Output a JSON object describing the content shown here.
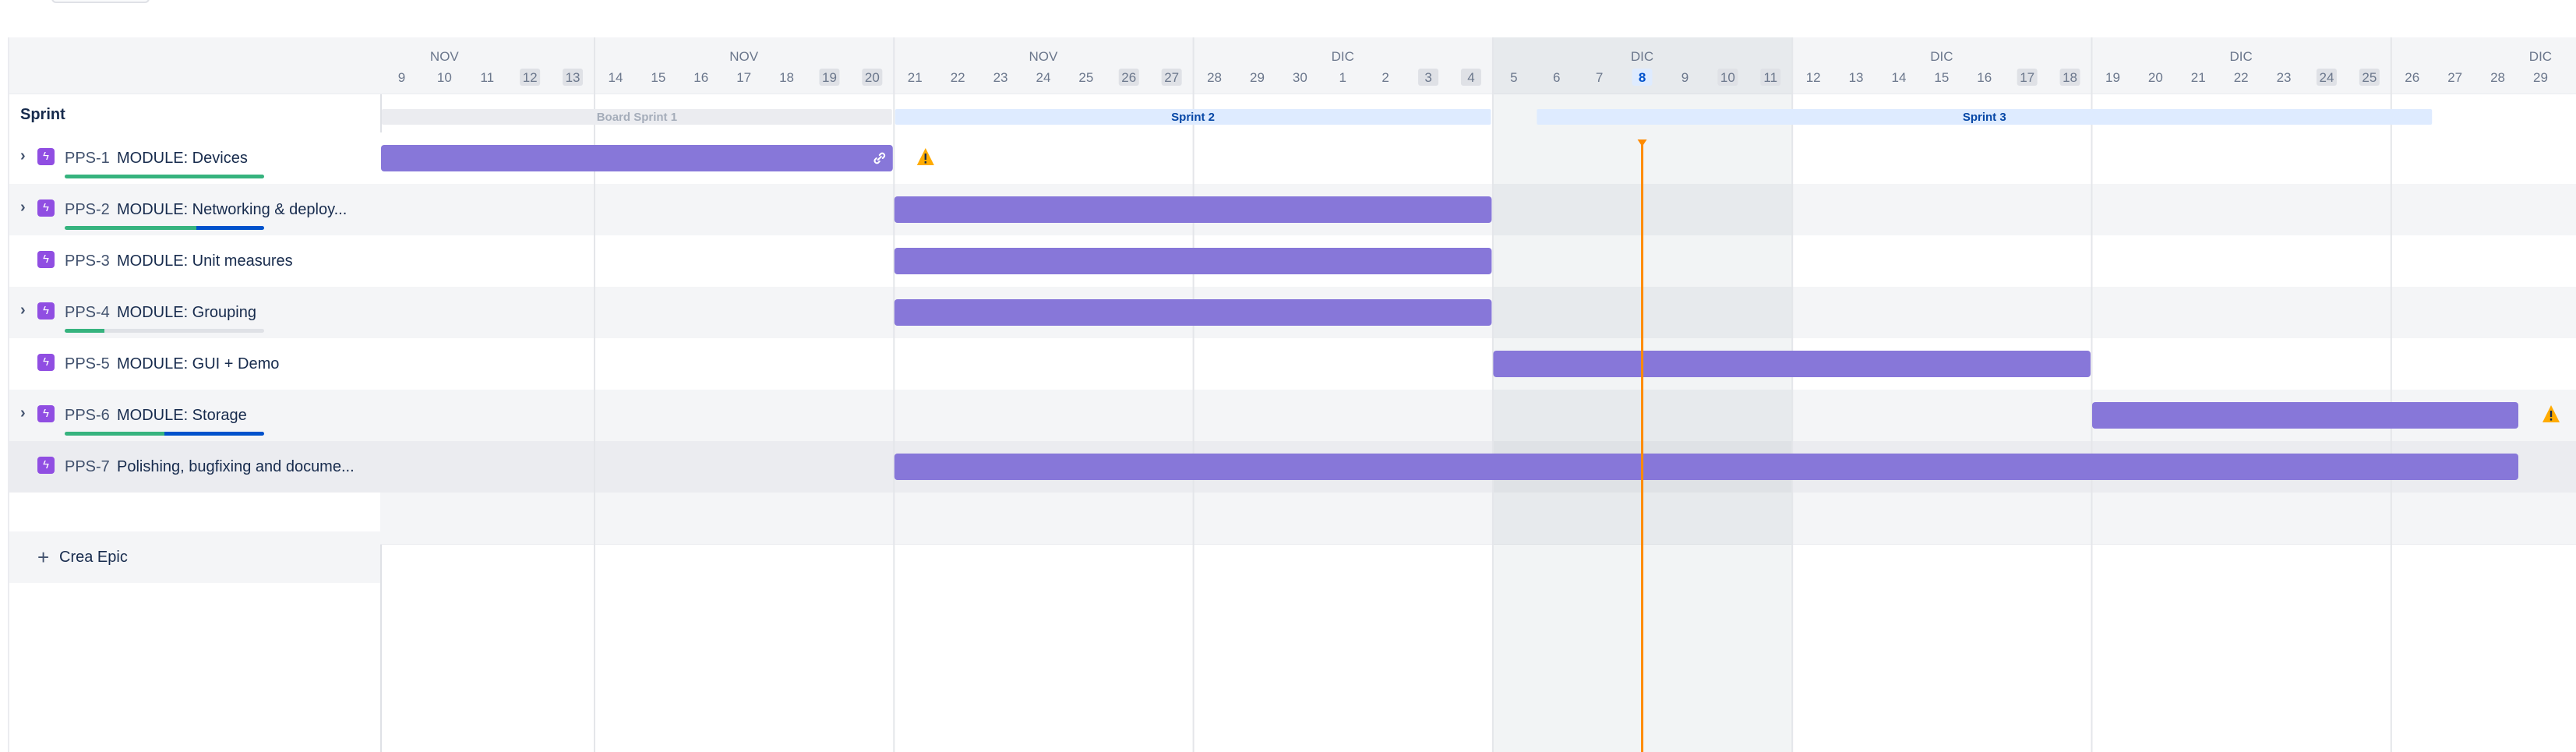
{
  "sidebar": {
    "sprint_label": "Sprint",
    "create_label": "Crea Epic",
    "epics": [
      {
        "key": "PPS-1",
        "title": "MODULE: Devices",
        "expandable": true,
        "done": 1.0,
        "in_progress": 0.0,
        "warning": true,
        "link": true,
        "start": 0,
        "end": 12
      },
      {
        "key": "PPS-2",
        "title": "MODULE: Networking & deploy...",
        "expandable": true,
        "done": 0.66,
        "in_progress": 0.34,
        "warning": false,
        "link": false,
        "start": 12,
        "end": 26
      },
      {
        "key": "PPS-3",
        "title": "MODULE: Unit measures",
        "expandable": false,
        "done": null,
        "in_progress": null,
        "warning": false,
        "link": false,
        "start": 12,
        "end": 26
      },
      {
        "key": "PPS-4",
        "title": "MODULE: Grouping",
        "expandable": true,
        "done": 0.2,
        "in_progress": 0.0,
        "warning": false,
        "link": false,
        "start": 12,
        "end": 26
      },
      {
        "key": "PPS-5",
        "title": "MODULE: GUI + Demo",
        "expandable": false,
        "done": null,
        "in_progress": null,
        "warning": false,
        "link": false,
        "start": 26,
        "end": 40
      },
      {
        "key": "PPS-6",
        "title": "MODULE: Storage",
        "expandable": true,
        "done": 0.5,
        "in_progress": 0.5,
        "warning": true,
        "link": false,
        "start": 40,
        "end": 50
      },
      {
        "key": "PPS-7",
        "title": "Polishing, bugfixing and docume...",
        "expandable": false,
        "done": null,
        "in_progress": null,
        "warning": false,
        "link": false,
        "start": 12,
        "end": 50
      }
    ]
  },
  "timeline": {
    "month_labels": [
      {
        "label": "NOV",
        "day_index": 1
      },
      {
        "label": "NOV",
        "day_index": 8
      },
      {
        "label": "NOV",
        "day_index": 15
      },
      {
        "label": "DIC",
        "day_index": 22
      },
      {
        "label": "DIC",
        "day_index": 29
      },
      {
        "label": "DIC",
        "day_index": 36
      },
      {
        "label": "DIC",
        "day_index": 43
      },
      {
        "label": "DIC",
        "day_index": 50
      }
    ],
    "days": [
      "9",
      "10",
      "11",
      "12",
      "13",
      "14",
      "15",
      "16",
      "17",
      "18",
      "19",
      "20",
      "21",
      "22",
      "23",
      "24",
      "25",
      "26",
      "27",
      "28",
      "29",
      "30",
      "1",
      "2",
      "3",
      "4",
      "5",
      "6",
      "7",
      "8",
      "9",
      "10",
      "11",
      "12",
      "13",
      "14",
      "15",
      "16",
      "17",
      "18",
      "19",
      "20",
      "21",
      "22",
      "23",
      "24",
      "25",
      "26",
      "27",
      "28",
      "29"
    ],
    "weekend_days": [
      3,
      4,
      10,
      11,
      17,
      18,
      24,
      25,
      31,
      32,
      38,
      39,
      45,
      46
    ],
    "today_index": 29,
    "highlight_week": {
      "start": 26,
      "end": 33
    },
    "week_separators": [
      5,
      12,
      19,
      26,
      33,
      40,
      47
    ],
    "sprints": [
      {
        "name": "Board Sprint 1",
        "start": 0,
        "end": 12,
        "status": "closed"
      },
      {
        "name": "Sprint 2",
        "start": 12,
        "end": 26,
        "status": "active"
      },
      {
        "name": "Sprint 3",
        "start": 27,
        "end": 48,
        "status": "future"
      }
    ]
  },
  "colors": {
    "bar": "#8777d9",
    "today": "#ff8b00",
    "sprint_closed": "#ebecf0",
    "sprint_closed_text": "#a5adba",
    "sprint_active": "#deebff",
    "sprint_active_text": "#0747a6",
    "warning": "#ffab00",
    "weekend_box": "#dfe1e6",
    "today_box": "#deebff",
    "today_text": "#0052cc"
  },
  "icons": {
    "epic": "lightning-icon",
    "expand": "chevron-right-icon",
    "warning": "warning-icon",
    "link": "link-icon",
    "add": "plus-icon"
  }
}
